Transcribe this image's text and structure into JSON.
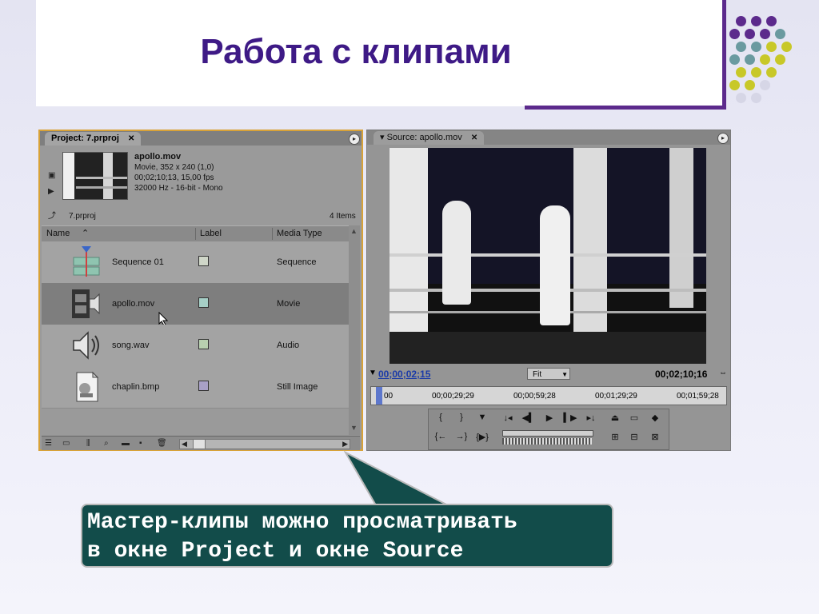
{
  "slide": {
    "title": "Работа с клипами",
    "callout_line1": "Мастер-клипы можно просматривать",
    "callout_line2": "в окне Project и окне Source",
    "colors": {
      "title": "#3e1a86",
      "accent": "#5c2a8c",
      "callout_bg": "#124c4a",
      "panel_border": "#d8a238"
    }
  },
  "project": {
    "tab_label": "Project: 7.prproj",
    "tab_close": "✕",
    "clip_name": "apollo.mov",
    "clip_line1": "Movie, 352 x 240 (1,0)",
    "clip_line2": "00;02;10;13, 15,00 fps",
    "clip_line3": "32000 Hz - 16-bit - Mono",
    "bin_name": "7.prproj",
    "item_count": "4 Items",
    "col_name": "Name",
    "col_label": "Label",
    "col_media_type": "Media Type",
    "rows": [
      {
        "name": "Sequence 01",
        "type": "Sequence",
        "label_color": "#cfd6c8",
        "icon": "sequence-icon"
      },
      {
        "name": "apollo.mov",
        "type": "Movie",
        "label_color": "#a6cfc6",
        "icon": "film-icon"
      },
      {
        "name": "song.wav",
        "type": "Audio",
        "label_color": "#b8d0b0",
        "icon": "speaker-icon"
      },
      {
        "name": "chaplin.bmp",
        "type": "Still Image",
        "label_color": "#a8a0c6",
        "icon": "image-file-icon"
      }
    ]
  },
  "source": {
    "tab_label": "Source: apollo.mov",
    "tab_close": "✕",
    "timecode_current": "00;00;02;15",
    "timecode_duration": "00;02;10;16",
    "zoom": "Fit",
    "ruler_marks": [
      "00",
      "00;00;29;29",
      "00;00;59;28",
      "00;01;29;29",
      "00;01;59;28"
    ]
  }
}
